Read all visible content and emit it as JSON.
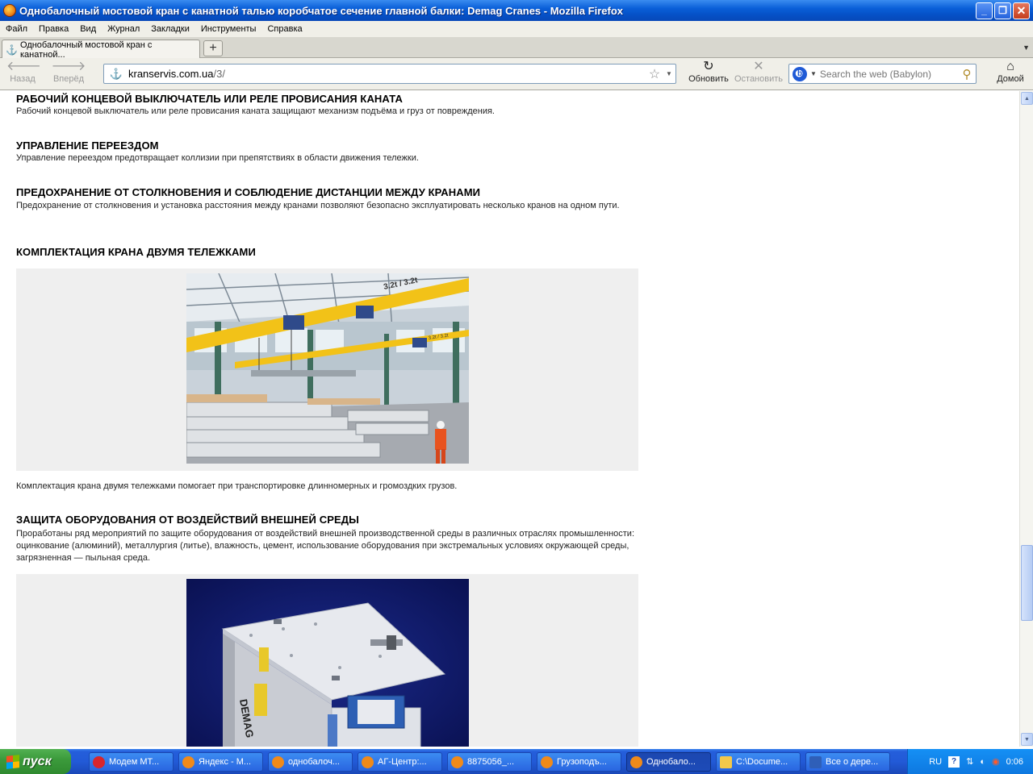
{
  "window": {
    "title": "Однобалочный мостовой кран с канатной талью коробчатое сечение главной балки: Demag Cranes - Mozilla Firefox",
    "minimize": "_",
    "maximize": "❐",
    "close": "✕"
  },
  "menu": [
    "Файл",
    "Правка",
    "Вид",
    "Журнал",
    "Закладки",
    "Инструменты",
    "Справка"
  ],
  "tab": {
    "label": "Однобалочный мостовой кран с канатной...",
    "new_tab": "+"
  },
  "nav": {
    "back": "Назад",
    "forward": "Вперёд",
    "url_host": "kranservis.com.ua",
    "url_path": "/3/",
    "reload": "Обновить",
    "stop": "Остановить",
    "search_placeholder": "Search the web (Babylon)",
    "home": "Домой"
  },
  "article": {
    "s1_title": "РАБОЧИЙ КОНЦЕВОЙ ВЫКЛЮЧАТЕЛЬ ИЛИ РЕЛЕ ПРОВИСАНИЯ КАНАТА",
    "s1_text": "Рабочий концевой выключатель или реле провисания каната защищают механизм подъёма и груз от повреждения.",
    "s2_title": "УПРАВЛЕНИЕ ПЕРЕЕЗДОМ",
    "s2_text": "Управление переездом предотвращает коллизии при препятствиях в области движения тележки.",
    "s3_title": "ПРЕДОХРАНЕНИЕ ОТ СТОЛКНОВЕНИЯ И СОБЛЮДЕНИЕ ДИСТАНЦИИ МЕЖДУ КРАНАМИ",
    "s3_text": "Предохранение от столкновения и установка расстояния между кранами позволяют безопасно эксплуатировать несколько кранов на одном пути.",
    "s4_title": "КОМПЛЕКТАЦИЯ КРАНА ДВУМЯ ТЕЛЕЖКАМИ",
    "s4_image_label_1": "3.2t / 3.2t",
    "s4_image_label_2": "3.2t / 3.2t",
    "s4_text": "Комплектация крана двумя тележками помогает при транспортировке длинномерных и громоздких грузов.",
    "s5_title": "ЗАЩИТА ОБОРУДОВАНИЯ ОТ ВОЗДЕЙСТВИЙ ВНЕШНЕЙ СРЕДЫ",
    "s5_text": "Проработаны ряд мероприятий по защите оборудования от воздействий внешней производственной среды в различных отраслях промышленности: оцинкование (алюминий), металлургия (литье), влажность, цемент, использование оборудования при экстремальных условиях окружающей среды, загрязненная — пыльная среда.",
    "s5_image_label": "DEMAG"
  },
  "taskbar": {
    "start": "пуск",
    "tasks": [
      {
        "label": "Модем МТ...",
        "color": "#d8262c"
      },
      {
        "label": "Яндекс - М...",
        "color": "#f08a1a"
      },
      {
        "label": "однобалоч...",
        "color": "#f08a1a"
      },
      {
        "label": "АГ-Центр:...",
        "color": "#f08a1a"
      },
      {
        "label": "8875056_...",
        "color": "#f08a1a"
      },
      {
        "label": "Грузоподъ...",
        "color": "#f08a1a"
      },
      {
        "label": "Однобало...",
        "color": "#f08a1a"
      },
      {
        "label": "C:\\Docume...",
        "color": "#f3c84a"
      },
      {
        "label": "Все о дере...",
        "color": "#2f5fb8"
      }
    ],
    "lang": "RU",
    "clock": "0:06"
  },
  "colors": {
    "titlebar": "#0a5fd8",
    "taskbar": "#245edb",
    "start": "#3c9b3c",
    "crane_yellow": "#f2c218"
  }
}
